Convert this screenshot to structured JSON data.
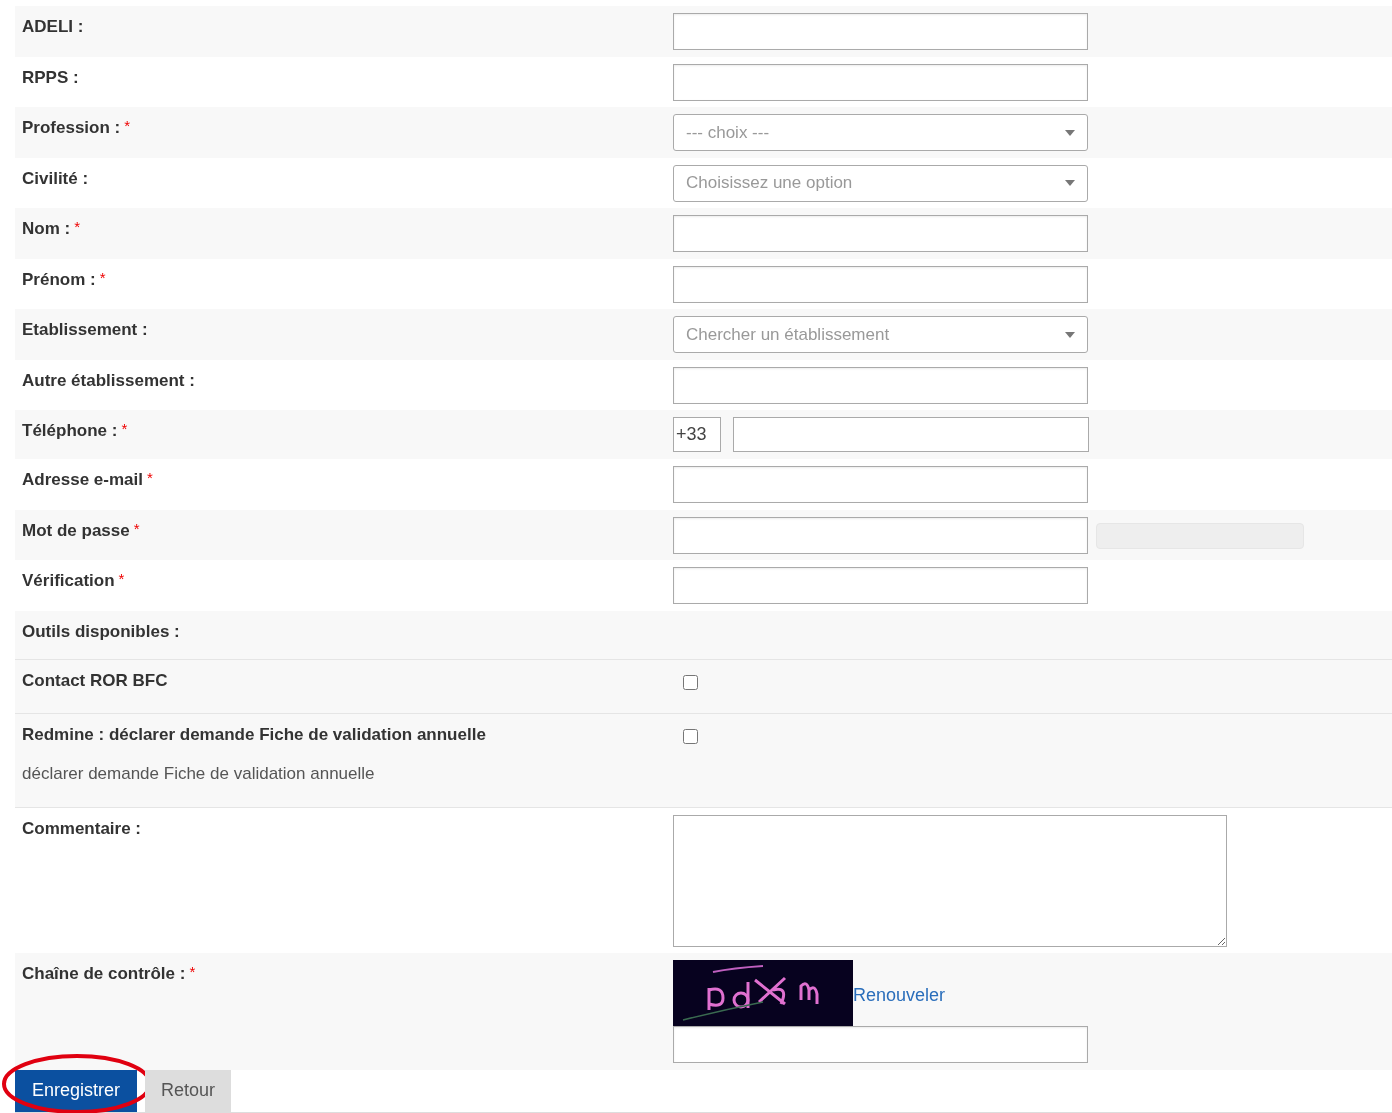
{
  "rows": [
    {
      "kind": "text",
      "label": "ADELI :"
    },
    {
      "kind": "text",
      "label": "RPPS :"
    },
    {
      "kind": "select",
      "label": "Profession :",
      "required_mark": "*",
      "placeholder": "--- choix ---"
    },
    {
      "kind": "select",
      "label": "Civilité :",
      "placeholder": "Choisissez une option"
    },
    {
      "kind": "text",
      "label": "Nom :",
      "required_mark": "*"
    },
    {
      "kind": "text",
      "label": "Prénom :",
      "required_mark": "*"
    },
    {
      "kind": "select",
      "label": "Etablissement :",
      "placeholder": "Chercher un établissement"
    },
    {
      "kind": "text",
      "label": "Autre établissement :"
    },
    {
      "kind": "phone",
      "label": "Téléphone :",
      "required_mark": "*",
      "prefix": "+33"
    },
    {
      "kind": "text",
      "label": "Adresse e-mail",
      "required_mark": "*"
    },
    {
      "kind": "password",
      "label": "Mot de passe",
      "required_mark": "*",
      "strength": {
        "level": 0
      }
    },
    {
      "kind": "text",
      "label": "Vérification",
      "required_mark": "*"
    },
    {
      "kind": "heading",
      "label": "Outils disponibles :"
    },
    {
      "kind": "checkbox",
      "label": "Contact ROR BFC",
      "checked": false
    },
    {
      "kind": "checkbox",
      "label": "Redmine : déclarer demande Fiche de validation annuelle",
      "checked": false,
      "description": "déclarer demande Fiche de validation annuelle"
    },
    {
      "kind": "textarea",
      "label": "Commentaire :"
    },
    {
      "kind": "captcha",
      "label": "Chaîne de contrôle :",
      "required_mark": "*",
      "link": "Renouveler"
    }
  ],
  "buttons": [
    {
      "label": "Enregistrer",
      "primary": true,
      "circled": true
    },
    {
      "label": "Retour",
      "primary": false,
      "circled": false
    }
  ]
}
